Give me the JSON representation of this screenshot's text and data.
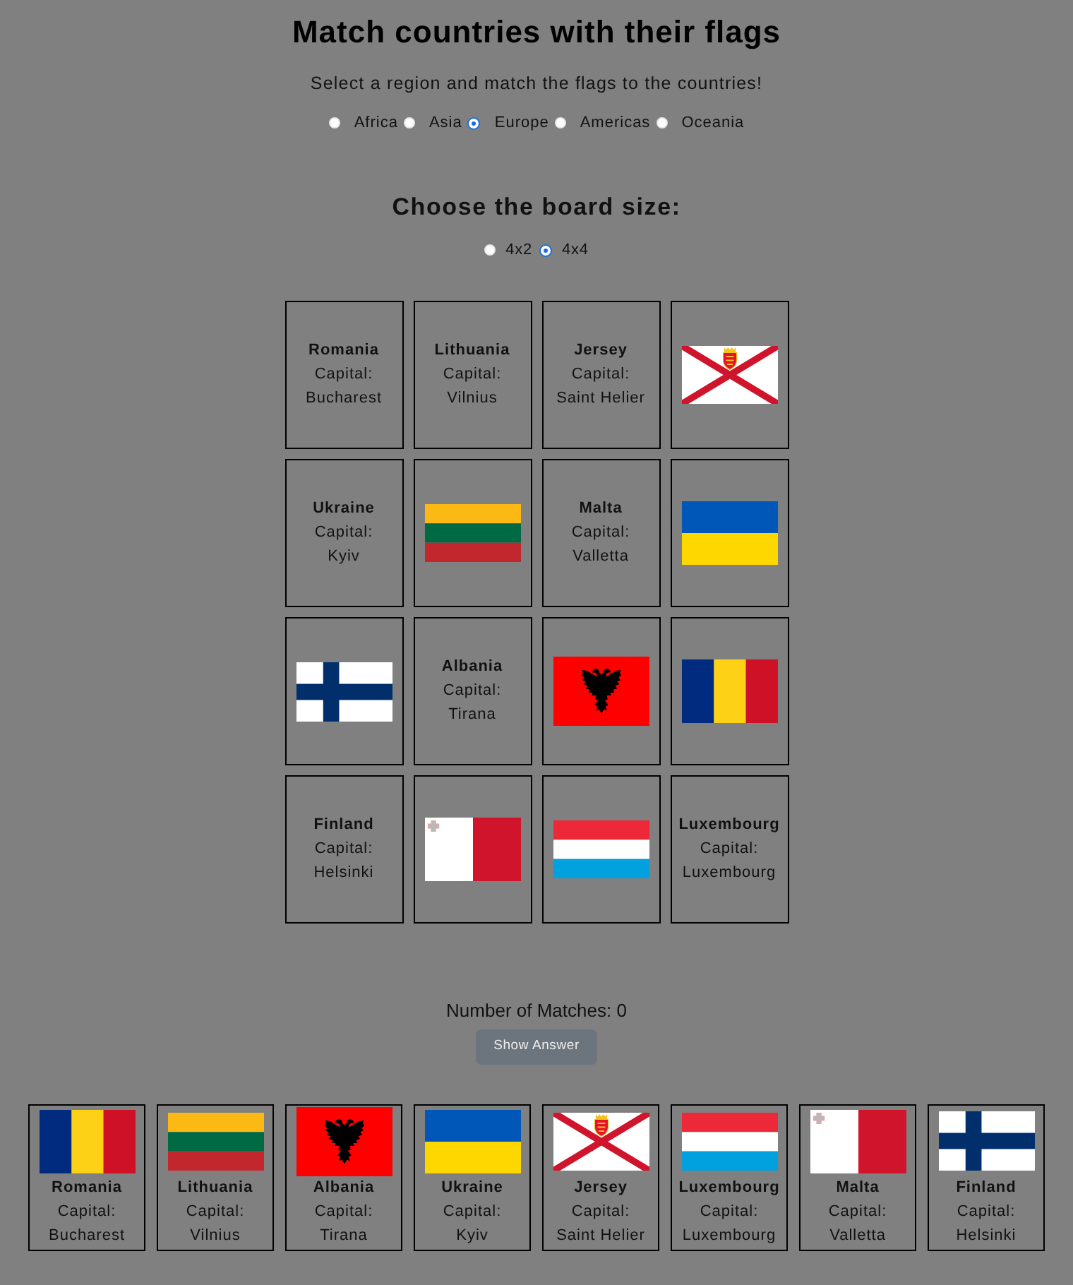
{
  "title": "Match countries with their flags",
  "subtitle": "Select a region and match the flags to the countries!",
  "regions": [
    {
      "label": "Africa",
      "selected": false
    },
    {
      "label": "Asia",
      "selected": false
    },
    {
      "label": "Europe",
      "selected": true
    },
    {
      "label": "Americas",
      "selected": false
    },
    {
      "label": "Oceania",
      "selected": false
    }
  ],
  "board_size": {
    "heading": "Choose the board size:",
    "options": [
      {
        "label": "4x2",
        "selected": false
      },
      {
        "label": "4x4",
        "selected": true
      }
    ]
  },
  "board": [
    {
      "kind": "country",
      "name": "Romania",
      "capital_label": "Capital:",
      "capital": "Bucharest"
    },
    {
      "kind": "country",
      "name": "Lithuania",
      "capital_label": "Capital:",
      "capital": "Vilnius"
    },
    {
      "kind": "country",
      "name": "Jersey",
      "capital_label": "Capital:",
      "capital": "Saint Helier"
    },
    {
      "kind": "flag",
      "flag": {
        "kind": "jersey"
      }
    },
    {
      "kind": "country",
      "name": "Ukraine",
      "capital_label": "Capital:",
      "capital": "Kyiv"
    },
    {
      "kind": "flag",
      "flag": {
        "kind": "lithuania"
      }
    },
    {
      "kind": "country",
      "name": "Malta",
      "capital_label": "Capital:",
      "capital": "Valletta"
    },
    {
      "kind": "flag",
      "flag": {
        "kind": "ukraine"
      }
    },
    {
      "kind": "flag",
      "flag": {
        "kind": "finland"
      }
    },
    {
      "kind": "country",
      "name": "Albania",
      "capital_label": "Capital:",
      "capital": "Tirana"
    },
    {
      "kind": "flag",
      "flag": {
        "kind": "albania"
      }
    },
    {
      "kind": "flag",
      "flag": {
        "kind": "romania"
      }
    },
    {
      "kind": "country",
      "name": "Finland",
      "capital_label": "Capital:",
      "capital": "Helsinki"
    },
    {
      "kind": "flag",
      "flag": {
        "kind": "malta"
      }
    },
    {
      "kind": "flag",
      "flag": {
        "kind": "luxembourg"
      }
    },
    {
      "kind": "country",
      "name": "Luxembourg",
      "capital_label": "Capital:",
      "capital": "Luxembourg"
    }
  ],
  "matches": "Number of Matches: 0",
  "show_answer_button": "Show Answer",
  "answers": [
    {
      "flag": {
        "kind": "romania"
      },
      "name": "Romania",
      "capital_label": "Capital:",
      "capital": "Bucharest"
    },
    {
      "flag": {
        "kind": "lithuania"
      },
      "name": "Lithuania",
      "capital_label": "Capital:",
      "capital": "Vilnius"
    },
    {
      "flag": {
        "kind": "albania"
      },
      "name": "Albania",
      "capital_label": "Capital:",
      "capital": "Tirana"
    },
    {
      "flag": {
        "kind": "ukraine"
      },
      "name": "Ukraine",
      "capital_label": "Capital:",
      "capital": "Kyiv"
    },
    {
      "flag": {
        "kind": "jersey"
      },
      "name": "Jersey",
      "capital_label": "Capital:",
      "capital": "Saint Helier"
    },
    {
      "flag": {
        "kind": "luxembourg"
      },
      "name": "Luxembourg",
      "capital_label": "Capital:",
      "capital": "Luxembourg"
    },
    {
      "flag": {
        "kind": "malta"
      },
      "name": "Malta",
      "capital_label": "Capital:",
      "capital": "Valletta"
    },
    {
      "flag": {
        "kind": "finland"
      },
      "name": "Finland",
      "capital_label": "Capital:",
      "capital": "Helsinki"
    }
  ]
}
